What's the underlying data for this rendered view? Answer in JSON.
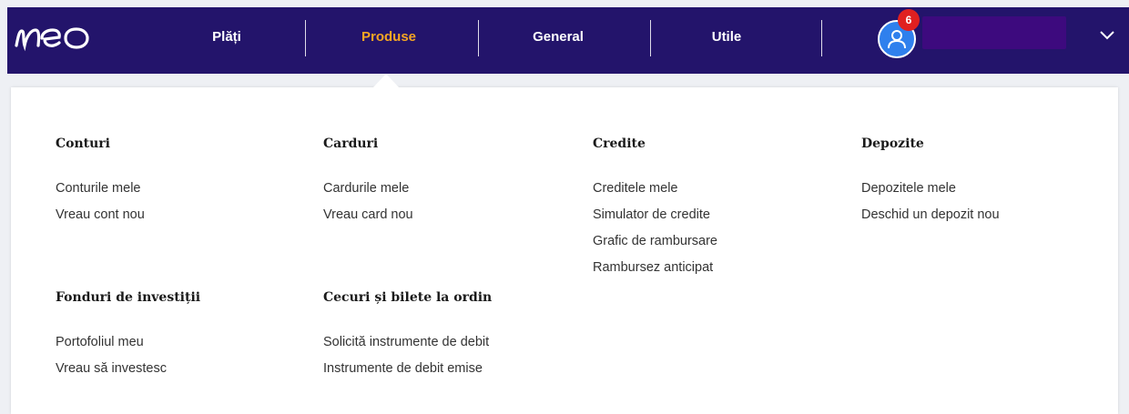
{
  "colors": {
    "header_bg": "#23146b",
    "active_nav": "#f5a623",
    "avatar_bg": "#2f80ed",
    "badge_bg": "#e02020"
  },
  "header": {
    "logo_icon": "neo-logo",
    "nav": [
      {
        "label": "Plăți",
        "active": false
      },
      {
        "label": "Produse",
        "active": true
      },
      {
        "label": "General",
        "active": false
      },
      {
        "label": "Utile",
        "active": false
      }
    ],
    "notifications_count": "6",
    "avatar_icon": "user-icon",
    "menu_icon": "chevron-down-icon"
  },
  "menu": {
    "conturi": {
      "title": "Conturi",
      "links": [
        "Conturile mele",
        "Vreau cont nou"
      ]
    },
    "carduri": {
      "title": "Carduri",
      "links": [
        "Cardurile mele",
        "Vreau card nou"
      ]
    },
    "credite": {
      "title": "Credite",
      "links": [
        "Creditele mele",
        "Simulator de credite",
        "Grafic de rambursare",
        "Rambursez anticipat"
      ]
    },
    "depozite": {
      "title": "Depozite",
      "links": [
        "Depozitele mele",
        "Deschid un depozit nou"
      ]
    },
    "fonduri": {
      "title": "Fonduri de investiții",
      "links": [
        "Portofoliul meu",
        "Vreau să investesc"
      ]
    },
    "cecuri": {
      "title": "Cecuri și bilete la ordin",
      "links": [
        "Solicită instrumente de debit",
        "Instrumente de debit emise"
      ]
    }
  }
}
